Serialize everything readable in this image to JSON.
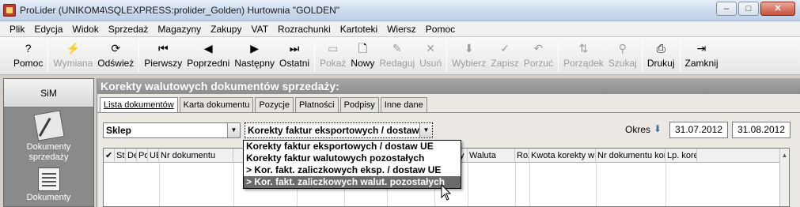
{
  "window": {
    "title": "ProLider  (UNIKOM4\\SQLEXPRESS:prolider_Golden) Hurtownia \"GOLDEN\"",
    "min_glyph": "–",
    "max_glyph": "□",
    "close_glyph": "✕"
  },
  "menu": [
    "Plik",
    "Edycja",
    "Widok",
    "Sprzedaż",
    "Magazyny",
    "Zakupy",
    "VAT",
    "Rozrachunki",
    "Kartoteki",
    "Wiersz",
    "Pomoc"
  ],
  "toolbar": [
    {
      "label": "Pomoc",
      "icon": "help-icon",
      "glyph": "?",
      "disabled": false
    },
    {
      "label": "Wymiana",
      "icon": "exchange-icon",
      "glyph": "⚡",
      "disabled": true
    },
    {
      "label": "Odśwież",
      "icon": "refresh-icon",
      "glyph": "⟳",
      "disabled": false
    },
    {
      "label": "Pierwszy",
      "icon": "first-icon",
      "glyph": "⏮",
      "disabled": false
    },
    {
      "label": "Poprzedni",
      "icon": "prev-icon",
      "glyph": "◀",
      "disabled": false
    },
    {
      "label": "Następny",
      "icon": "next-icon",
      "glyph": "▶",
      "disabled": false
    },
    {
      "label": "Ostatni",
      "icon": "last-icon",
      "glyph": "⏭",
      "disabled": false
    },
    {
      "label": "Pokaż",
      "icon": "show-icon",
      "glyph": "▭",
      "disabled": true
    },
    {
      "label": "Nowy",
      "icon": "new-icon",
      "glyph": "🗋",
      "disabled": false
    },
    {
      "label": "Redaguj",
      "icon": "edit-icon",
      "glyph": "✎",
      "disabled": true
    },
    {
      "label": "Usuń",
      "icon": "delete-icon",
      "glyph": "✕",
      "disabled": true
    },
    {
      "label": "Wybierz",
      "icon": "select-icon",
      "glyph": "⬇",
      "disabled": true
    },
    {
      "label": "Zapisz",
      "icon": "save-icon",
      "glyph": "✓",
      "disabled": true
    },
    {
      "label": "Porzuć",
      "icon": "undo-icon",
      "glyph": "↶",
      "disabled": true
    },
    {
      "label": "Porządek",
      "icon": "sort-icon",
      "glyph": "⇅",
      "disabled": true
    },
    {
      "label": "Szukaj",
      "icon": "binoculars-icon",
      "glyph": "⚲",
      "disabled": true
    },
    {
      "label": "Drukuj",
      "icon": "print-icon",
      "glyph": "⎙",
      "disabled": false
    },
    {
      "label": "Zamknij",
      "icon": "exit-icon",
      "glyph": "⇥",
      "disabled": false
    }
  ],
  "left_panel": {
    "header": "SiM",
    "items": [
      "Dokumenty sprzedaży",
      "Dokumenty"
    ]
  },
  "main": {
    "title": "Korekty walutowych dokumentów sprzedaży:",
    "tabs": [
      {
        "label": "Lista dokumentów",
        "active": true
      },
      {
        "label": "Karta dokumentu",
        "active": false
      },
      {
        "label": "Pozycje",
        "active": false
      },
      {
        "label": "Płatności",
        "active": false
      },
      {
        "label": "Podpisy",
        "active": false
      },
      {
        "label": "Inne dane",
        "active": false
      }
    ],
    "store_select": "Sklep",
    "type_select": "Korekty faktur eksportowych / dostaw",
    "okres_label": "Okres",
    "date_from": "31.07.2012",
    "date_to": "31.08.2012",
    "dropdown_options": [
      "Korekty faktur eksportowych / dostaw UE",
      "Korekty faktur walutowych pozostałych",
      "> Kor. fakt. zaliczkowych eksp. / dostaw UE",
      "> Kor. fakt. zaliczkowych walut. pozostałych"
    ],
    "dropdown_selected_index": 3
  },
  "grid": {
    "columns": [
      "✔",
      "St",
      "De",
      "Po",
      "UE",
      "Nr dokumentu",
      "",
      "",
      "",
      "",
      "korekty",
      "Waluta",
      "Roz",
      "Kwota korekty w zł",
      "Nr dokumentu kor.",
      "Lp. kore"
    ]
  }
}
